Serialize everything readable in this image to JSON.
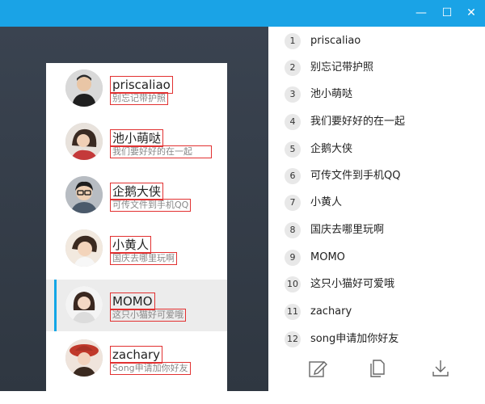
{
  "window": {
    "minimize_glyph": "—",
    "maximize_glyph": "☐",
    "close_glyph": "✕",
    "accent_color": "#1aa3e6"
  },
  "contacts": [
    {
      "name": "priscaliao",
      "message": "别忘记带护照",
      "avatar": "man-avatar"
    },
    {
      "name": "池小萌哒",
      "message": "我们要好好的在一起",
      "avatar": "girl-avatar"
    },
    {
      "name": "企鹅大侠",
      "message": "可传文件到手机QQ",
      "avatar": "glasses-boy-avatar"
    },
    {
      "name": "小黄人",
      "message": "国庆去哪里玩啊",
      "avatar": "child-avatar"
    },
    {
      "name": "MOMO",
      "message": "这只小猫好可爱哦",
      "avatar": "woman-avatar",
      "selected": true
    },
    {
      "name": "zachary",
      "message": "Song申请加你好友",
      "avatar": "hat-girl-avatar"
    }
  ],
  "list": [
    {
      "num": "1",
      "label": "priscaliao"
    },
    {
      "num": "2",
      "label": "别忘记带护照"
    },
    {
      "num": "3",
      "label": "池小萌哒"
    },
    {
      "num": "4",
      "label": "我们要好好的在一起"
    },
    {
      "num": "5",
      "label": "企鹅大侠"
    },
    {
      "num": "6",
      "label": "可传文件到手机QQ"
    },
    {
      "num": "7",
      "label": "小黄人"
    },
    {
      "num": "8",
      "label": "国庆去哪里玩啊"
    },
    {
      "num": "9",
      "label": "MOMO"
    },
    {
      "num": "10",
      "label": "这只小猫好可爱哦"
    },
    {
      "num": "11",
      "label": "zachary"
    },
    {
      "num": "12",
      "label": "song申请加你好友"
    }
  ],
  "toolbar": {
    "edit_icon": "edit-icon",
    "copy_icon": "copy-icon",
    "download_icon": "download-icon"
  }
}
